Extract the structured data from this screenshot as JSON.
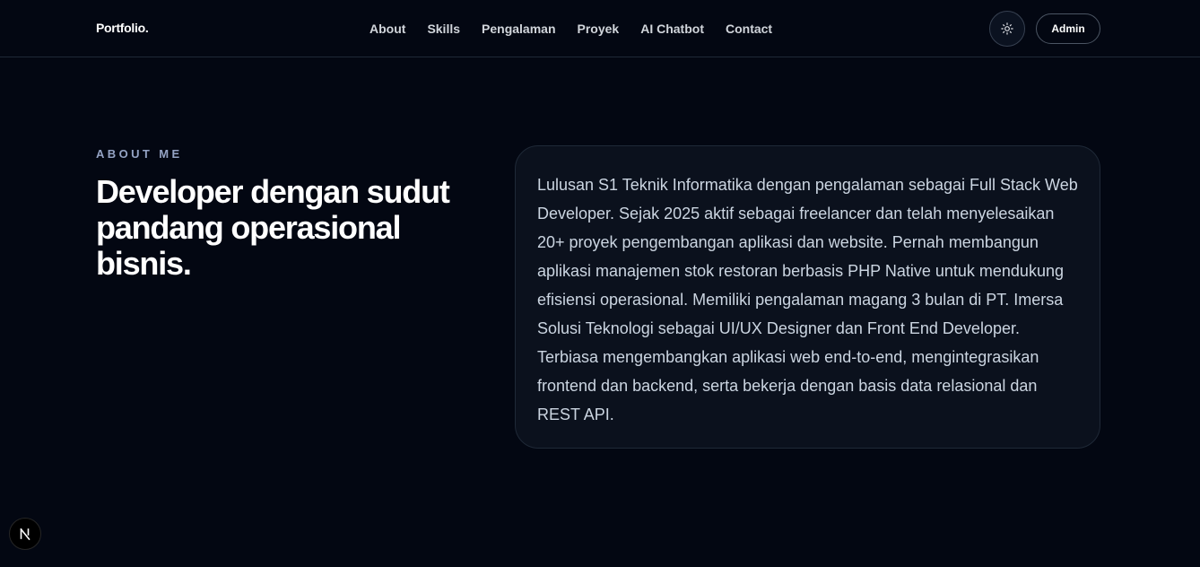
{
  "header": {
    "logo": "Portfolio.",
    "nav": [
      "About",
      "Skills",
      "Pengalaman",
      "Proyek",
      "AI Chatbot",
      "Contact"
    ],
    "theme_toggle_icon": "sun-icon",
    "admin_label": "Admin"
  },
  "about": {
    "eyebrow": "ABOUT ME",
    "headline": "Developer dengan sudut pandang operasional bisnis.",
    "description": "Lulusan S1 Teknik Informatika dengan pengalaman sebagai Full Stack Web Developer. Sejak 2025 aktif sebagai freelancer dan telah menyelesaikan 20+ proyek pengembangan aplikasi dan website. Pernah membangun aplikasi manajemen stok restoran berbasis PHP Native untuk mendukung efisiensi operasional. Memiliki pengalaman magang 3 bulan di PT. Imersa Solusi Teknologi sebagai UI/UX Designer dan Front End Developer. Terbiasa mengembangkan aplikasi web end-to-end, mengintegrasikan frontend dan backend, serta bekerja dengan basis data relasional dan REST API."
  },
  "dev_badge": {
    "icon": "nextjs-logo-icon",
    "letter": "N"
  },
  "colors": {
    "background": "#030712",
    "card": "#0b111d",
    "eyebrow": "#94a3c4",
    "text": "#cbd5e1"
  }
}
